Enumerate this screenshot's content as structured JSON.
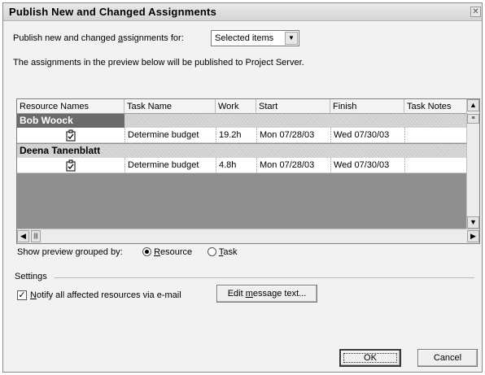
{
  "window": {
    "title": "Publish New and Changed Assignments",
    "close_glyph": "✕"
  },
  "publish_for": {
    "label_pre": "Publish new and changed ",
    "label_ul": "a",
    "label_post": "ssignments for:",
    "selected": "Selected items"
  },
  "info_text": "The assignments in the preview below will be published to Project Server.",
  "grid": {
    "columns": [
      "Resource Names",
      "Task Name",
      "Work",
      "Start",
      "Finish",
      "Task Notes"
    ],
    "groups": [
      {
        "resource": "Bob Woock",
        "tasks": [
          {
            "task_name": "Determine budget",
            "work": "19.2h",
            "start": "Mon 07/28/03",
            "finish": "Wed 07/30/03",
            "notes": ""
          }
        ]
      },
      {
        "resource": "Deena Tanenblatt",
        "tasks": [
          {
            "task_name": "Determine budget",
            "work": "4.8h",
            "start": "Mon 07/28/03",
            "finish": "Wed 07/30/03",
            "notes": ""
          }
        ]
      }
    ],
    "scroll_up_glyph": "▲",
    "scroll_down_glyph": "▼",
    "scroll_left_glyph": "◀",
    "scroll_right_glyph": "▶"
  },
  "grouping": {
    "label_pre": "Show preview grouped by:",
    "options": [
      {
        "ul": "R",
        "rest": "esource",
        "selected": true
      },
      {
        "ul": "T",
        "rest": "ask",
        "selected": false
      }
    ]
  },
  "settings": {
    "heading": "Settings",
    "notify_ul": "N",
    "notify_rest": "otify all affected resources via e-mail",
    "notify_checked": true,
    "check_glyph": "✓",
    "edit_pre": "Edit ",
    "edit_ul": "m",
    "edit_post": "essage text..."
  },
  "buttons": {
    "ok": "OK",
    "cancel": "Cancel"
  },
  "icons": {
    "close": "close-icon",
    "dropdown": "chevron-down-icon",
    "task": "assignment-task-icon"
  }
}
